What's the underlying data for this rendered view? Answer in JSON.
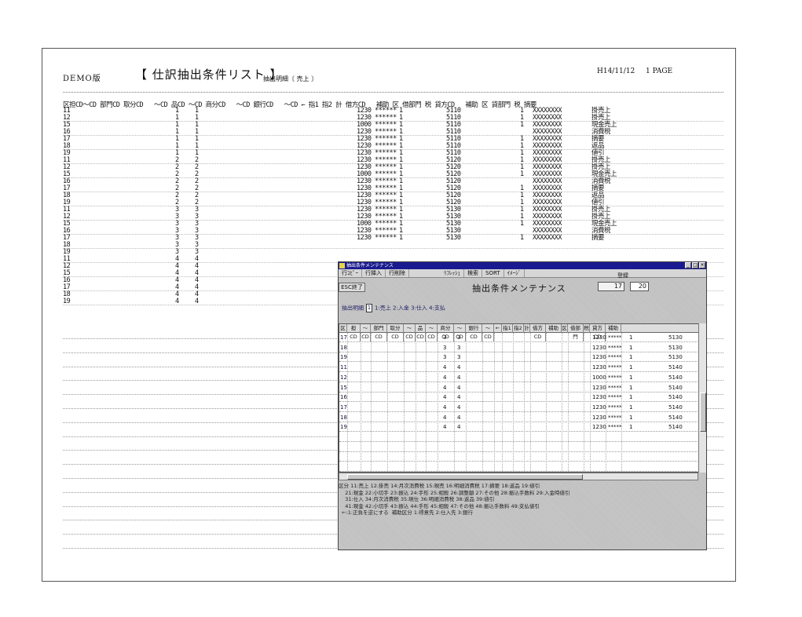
{
  "report": {
    "demo": "DEMO版",
    "title": "【 仕訳抽出条件リスト 】",
    "subtitle": "抽出明細〔 売上 〕",
    "date": "H14/11/12",
    "page": "1 PAGE",
    "column_header": "区担CD～CD 部門CD 取分CD   ～CD 品CD ～CD 商分CD   ～CD 銀行CD   ～CD ← 指1 指2 計 借方CD   補助 区 借部門 税 貸方CD   補助 区 貸部門 税 摘要",
    "rows": [
      {
        "kb": "11",
        "n1": "1",
        "n2": "1",
        "amt": "1230",
        "st": "******",
        "one": "1",
        "acc": "5110",
        "one2": "1",
        "xx": "XXXXXXXX",
        "desc": "掛売上"
      },
      {
        "kb": "12",
        "n1": "1",
        "n2": "1",
        "amt": "1230",
        "st": "******",
        "one": "1",
        "acc": "5110",
        "one2": "1",
        "xx": "XXXXXXXX",
        "desc": "掛売上"
      },
      {
        "kb": "15",
        "n1": "1",
        "n2": "1",
        "amt": "1000",
        "st": "******",
        "one": "1",
        "acc": "5110",
        "one2": "1",
        "xx": "XXXXXXXX",
        "desc": "現金売上"
      },
      {
        "kb": "16",
        "n1": "1",
        "n2": "1",
        "amt": "1230",
        "st": "******",
        "one": "1",
        "acc": "5110",
        "one2": "",
        "xx": "XXXXXXXX",
        "desc": "消費税"
      },
      {
        "kb": "17",
        "n1": "1",
        "n2": "1",
        "amt": "1230",
        "st": "******",
        "one": "1",
        "acc": "5110",
        "one2": "1",
        "xx": "XXXXXXXX",
        "desc": "摘要"
      },
      {
        "kb": "18",
        "n1": "1",
        "n2": "1",
        "amt": "1230",
        "st": "******",
        "one": "1",
        "acc": "5110",
        "one2": "1",
        "xx": "XXXXXXXX",
        "desc": "返品"
      },
      {
        "kb": "19",
        "n1": "1",
        "n2": "1",
        "amt": "1230",
        "st": "******",
        "one": "1",
        "acc": "5110",
        "one2": "1",
        "xx": "XXXXXXXX",
        "desc": "値引"
      },
      {
        "kb": "11",
        "n1": "2",
        "n2": "2",
        "amt": "1230",
        "st": "******",
        "one": "1",
        "acc": "5120",
        "one2": "1",
        "xx": "XXXXXXXX",
        "desc": "掛売上"
      },
      {
        "kb": "12",
        "n1": "2",
        "n2": "2",
        "amt": "1230",
        "st": "******",
        "one": "1",
        "acc": "5120",
        "one2": "1",
        "xx": "XXXXXXXX",
        "desc": "掛売上"
      },
      {
        "kb": "15",
        "n1": "2",
        "n2": "2",
        "amt": "1000",
        "st": "******",
        "one": "1",
        "acc": "5120",
        "one2": "1",
        "xx": "XXXXXXXX",
        "desc": "現金売上"
      },
      {
        "kb": "16",
        "n1": "2",
        "n2": "2",
        "amt": "1230",
        "st": "******",
        "one": "1",
        "acc": "5120",
        "one2": "",
        "xx": "XXXXXXXX",
        "desc": "消費税"
      },
      {
        "kb": "17",
        "n1": "2",
        "n2": "2",
        "amt": "1230",
        "st": "******",
        "one": "1",
        "acc": "5120",
        "one2": "1",
        "xx": "XXXXXXXX",
        "desc": "摘要"
      },
      {
        "kb": "18",
        "n1": "2",
        "n2": "2",
        "amt": "1230",
        "st": "******",
        "one": "1",
        "acc": "5120",
        "one2": "1",
        "xx": "XXXXXXXX",
        "desc": "返品"
      },
      {
        "kb": "19",
        "n1": "2",
        "n2": "2",
        "amt": "1230",
        "st": "******",
        "one": "1",
        "acc": "5120",
        "one2": "1",
        "xx": "XXXXXXXX",
        "desc": "値引"
      },
      {
        "kb": "11",
        "n1": "3",
        "n2": "3",
        "amt": "1230",
        "st": "******",
        "one": "1",
        "acc": "5130",
        "one2": "1",
        "xx": "XXXXXXXX",
        "desc": "掛売上"
      },
      {
        "kb": "12",
        "n1": "3",
        "n2": "3",
        "amt": "1230",
        "st": "******",
        "one": "1",
        "acc": "5130",
        "one2": "1",
        "xx": "XXXXXXXX",
        "desc": "掛売上"
      },
      {
        "kb": "15",
        "n1": "3",
        "n2": "3",
        "amt": "1000",
        "st": "******",
        "one": "1",
        "acc": "5130",
        "one2": "1",
        "xx": "XXXXXXXX",
        "desc": "現金売上"
      },
      {
        "kb": "16",
        "n1": "3",
        "n2": "3",
        "amt": "1230",
        "st": "******",
        "one": "1",
        "acc": "5130",
        "one2": "",
        "xx": "XXXXXXXX",
        "desc": "消費税"
      },
      {
        "kb": "17",
        "n1": "3",
        "n2": "3",
        "amt": "1230",
        "st": "******",
        "one": "1",
        "acc": "5130",
        "one2": "1",
        "xx": "XXXXXXXX",
        "desc": "摘要"
      },
      {
        "kb": "18",
        "n1": "3",
        "n2": "3",
        "amt": "",
        "st": "",
        "one": "",
        "acc": "",
        "one2": "",
        "xx": "",
        "desc": ""
      },
      {
        "kb": "19",
        "n1": "3",
        "n2": "3",
        "amt": "",
        "st": "",
        "one": "",
        "acc": "",
        "one2": "",
        "xx": "",
        "desc": ""
      },
      {
        "kb": "11",
        "n1": "4",
        "n2": "4",
        "amt": "",
        "st": "",
        "one": "",
        "acc": "",
        "one2": "",
        "xx": "",
        "desc": ""
      },
      {
        "kb": "12",
        "n1": "4",
        "n2": "4",
        "amt": "",
        "st": "",
        "one": "",
        "acc": "",
        "one2": "",
        "xx": "",
        "desc": ""
      },
      {
        "kb": "15",
        "n1": "4",
        "n2": "4",
        "amt": "",
        "st": "",
        "one": "",
        "acc": "",
        "one2": "",
        "xx": "",
        "desc": ""
      },
      {
        "kb": "16",
        "n1": "4",
        "n2": "4",
        "amt": "",
        "st": "",
        "one": "",
        "acc": "",
        "one2": "",
        "xx": "",
        "desc": ""
      },
      {
        "kb": "17",
        "n1": "4",
        "n2": "4",
        "amt": "",
        "st": "",
        "one": "",
        "acc": "",
        "one2": "",
        "xx": "",
        "desc": ""
      },
      {
        "kb": "18",
        "n1": "4",
        "n2": "4",
        "amt": "",
        "st": "",
        "one": "",
        "acc": "",
        "one2": "",
        "xx": "",
        "desc": ""
      },
      {
        "kb": "19",
        "n1": "4",
        "n2": "4",
        "amt": "",
        "st": "",
        "one": "",
        "acc": "",
        "one2": "",
        "xx": "",
        "desc": ""
      }
    ]
  },
  "window": {
    "title": "抽出条件メンテナンス",
    "menu": [
      "行ｺﾋﾟｰ",
      "行挿入",
      "行削除",
      "ﾘﾌﾚｯｼｭ",
      "検索",
      "SORT",
      "ｲﾒｰｼﾞ"
    ],
    "register_label": "登録",
    "esc_label": "ESC終了",
    "heading": "抽出条件メンテナンス",
    "page_current": "17",
    "page_total": "20",
    "select_label": "抽出明細",
    "select_value": "1",
    "select_options": "1:売上 2:入金 3:仕入 4:支払",
    "grid_headers": [
      "区",
      "担CD",
      "～CD",
      "部門CD",
      "取分CD",
      "～CD",
      "品CD",
      "～CD",
      "商分CD",
      "～CD",
      "銀行CD",
      "～CD",
      "←",
      "指1",
      "指2",
      "計",
      "借方CD",
      "補助",
      "区",
      "借部門",
      "税",
      "貸方CD",
      "補助"
    ],
    "grid_rows": [
      {
        "kb": "17",
        "a": "3",
        "b": "3",
        "amt": "1230",
        "st": "*****",
        "one": "1",
        "acc": "5130"
      },
      {
        "kb": "18",
        "a": "3",
        "b": "3",
        "amt": "1230",
        "st": "*****",
        "one": "1",
        "acc": "5130"
      },
      {
        "kb": "19",
        "a": "3",
        "b": "3",
        "amt": "1230",
        "st": "*****",
        "one": "1",
        "acc": "5130"
      },
      {
        "kb": "11",
        "a": "4",
        "b": "4",
        "amt": "1230",
        "st": "*****",
        "one": "1",
        "acc": "5140"
      },
      {
        "kb": "12",
        "a": "4",
        "b": "4",
        "amt": "1000",
        "st": "*****",
        "one": "1",
        "acc": "5140"
      },
      {
        "kb": "15",
        "a": "4",
        "b": "4",
        "amt": "1230",
        "st": "*****",
        "one": "1",
        "acc": "5140"
      },
      {
        "kb": "16",
        "a": "4",
        "b": "4",
        "amt": "1230",
        "st": "*****",
        "one": "1",
        "acc": "5140"
      },
      {
        "kb": "17",
        "a": "4",
        "b": "4",
        "amt": "1230",
        "st": "*****",
        "one": "1",
        "acc": "5140"
      },
      {
        "kb": "18",
        "a": "4",
        "b": "4",
        "amt": "1230",
        "st": "*****",
        "one": "1",
        "acc": "5140"
      },
      {
        "kb": "19",
        "a": "4",
        "b": "4",
        "amt": "1230",
        "st": "*****",
        "one": "1",
        "acc": "5140"
      }
    ],
    "legend": "区分 11:売上 12:掛売 14:月次消費税 15:現売 16:明細消費税 17:摘要 18:返品 19:値引\n    21:現金 22:小切手 23:振込 24:手形 25:相殺 26:調整額 27:その他 28:振込手数料 29:入金時値引\n    31:仕入 34:月次消費税 35:現仕 36:明細消費税 38:返品 39:値引\n    41:現金 42:小切手 43:振込 44:手形 45:相殺 47:その他 48:振込手数料 49:支払値引\n  ←:1:正負を逆にする  補助区分 1:得意先 2:仕入先 3:銀行"
  }
}
